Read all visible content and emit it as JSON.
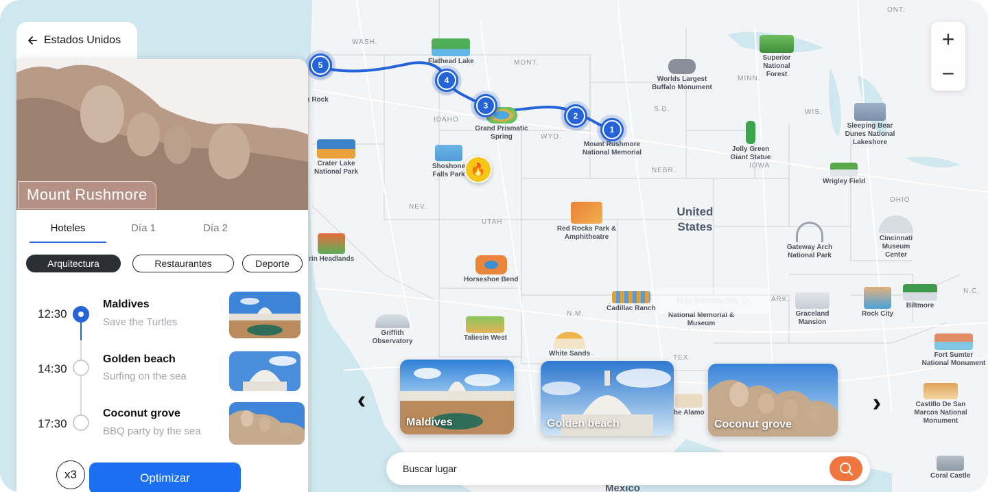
{
  "map": {
    "country": "United States",
    "mexico": "Mexico",
    "region_labels": [
      "ONT.",
      "WASH.",
      "MONT.",
      "MINN.",
      "S.D.",
      "WIS.",
      "IDAHO",
      "WYO.",
      "IOWA",
      "NEBR.",
      "NEV.",
      "UTAH",
      "OHIO",
      "N.M.",
      "ARK.",
      "TEX.",
      "N.C."
    ],
    "pois": {
      "superior": "Superior National Forest",
      "buffalo": "Worlds Largest Buffalo Monument",
      "flathead": "Flathead Lake",
      "rushmore": "Mount Rushmore National Memorial",
      "prismatic": "Grand Prismatic Spring",
      "crater": "Crater Lake National Park",
      "shoshone": "Shoshone Falls Park",
      "jolly": "Jolly Green Giant Statue",
      "sleeping_bear": "Sleeping Bear Dunes National Lakeshore",
      "wrigley": "Wrigley Field",
      "red_rocks": "Red Rocks Park & Amphitheatre",
      "gateway": "Gateway Arch National Park",
      "cincinnati": "Cincinnati Museum Center",
      "marin": "rin Headlands",
      "horseshoe": "Horseshoe Bend",
      "cadillac": "Cadillac Ranch",
      "national_memorial": "National Memorial & Museum",
      "graceland": "Graceland Mansion",
      "rock_city": "Rock City",
      "biltmore": "Biltmore",
      "griffith": "Griffith Observatory",
      "taliesin": "Taliesin West",
      "white_sands": "White Sands",
      "alamo": "he Alamo",
      "fort_sumter": "Fort Sumter National Monument",
      "castillo": "Castillo De San Marcos National Monument",
      "coral": "Coral Castle",
      "rock": "k Rock"
    },
    "route_stops": [
      "1",
      "2",
      "3",
      "4",
      "5"
    ],
    "more_info": "Más Información",
    "zoom": {
      "in": "+",
      "out": "−"
    }
  },
  "carousel": {
    "prev": "‹",
    "next": "›",
    "cards": [
      {
        "label": "Maldives"
      },
      {
        "label": "Golden beach"
      },
      {
        "label": "Coconut grove"
      }
    ]
  },
  "search": {
    "placeholder": "Buscar lugar"
  },
  "panel": {
    "back_label": "Estados Unidos",
    "hero_title": "Mount Rushmore",
    "tabs": [
      "Hoteles",
      "Día 1",
      "Día 2"
    ],
    "chips": [
      "Arquitectura",
      "Restaurantes",
      "Deporte"
    ],
    "timeline": [
      {
        "time": "12:30",
        "title": "Maldives",
        "subtitle": "Save the Turtles"
      },
      {
        "time": "14:30",
        "title": "Golden beach",
        "subtitle": "Surfing on the sea"
      },
      {
        "time": "17:30",
        "title": "Coconut grove",
        "subtitle": "BBQ party by the sea"
      }
    ],
    "multiplier": "x3",
    "optimize_label": "Optimizar"
  },
  "colors": {
    "accent": "#2463d8",
    "button": "#1d6ff2",
    "search_button": "#f0763f",
    "chip_active": "#2b2e33"
  }
}
